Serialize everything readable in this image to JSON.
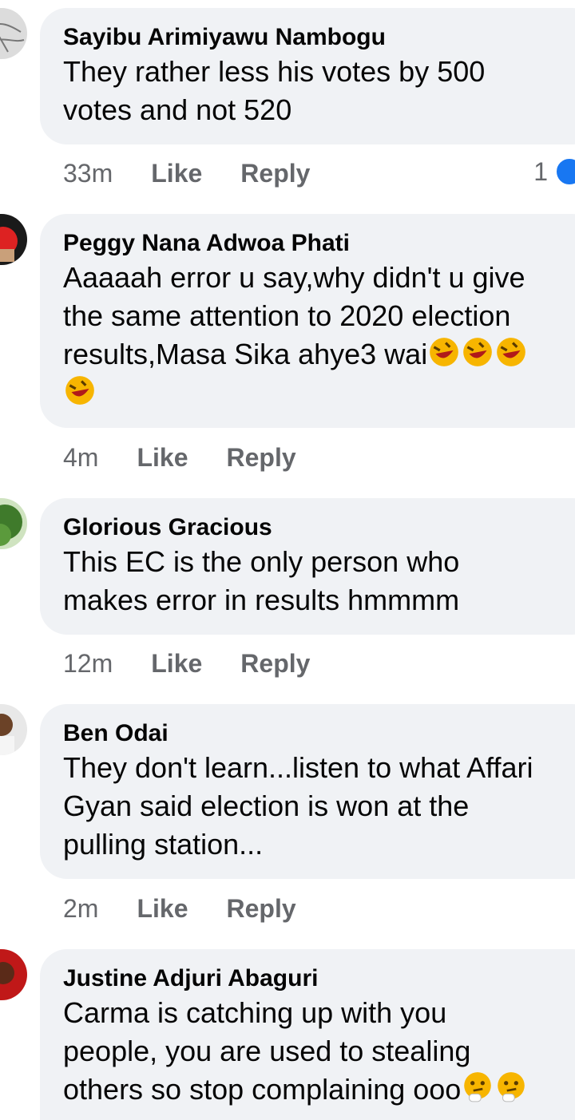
{
  "comments": [
    {
      "author": "Sayibu Arimiyawu Nambogu",
      "text": "They rather less his votes by 500\nvotes and not 520",
      "time": "33m",
      "like": "Like",
      "reply": "Reply",
      "reaction_count": "1"
    },
    {
      "author": "Peggy Nana Adwoa Phati",
      "text_line1": "Aaaaah error u say,why didn't u give",
      "text_line2": "the same attention to 2020 election",
      "text_line3": "results,Masa Sika ahye3 wai",
      "emoji": "rofl-emoji",
      "time": "4m",
      "like": "Like",
      "reply": "Reply"
    },
    {
      "author": "Glorious Gracious",
      "text": "This EC is the only person who\nmakes error in results hmmmm",
      "time": "12m",
      "like": "Like",
      "reply": "Reply"
    },
    {
      "author": "Ben Odai",
      "text": "They don't learn...listen to what Affari\nGyan said election is won at the\npulling station...",
      "time": "2m",
      "like": "Like",
      "reply": "Reply"
    },
    {
      "author": "Justine Adjuri Abaguri",
      "text_line1": "Carma is catching up with you",
      "text_line2": "people, you are used to stealing",
      "text_line3": "others so stop complaining ooo",
      "emoji": "thinking-face-emoji",
      "time": "",
      "like": "",
      "reply": ""
    }
  ],
  "colors": {
    "bubble": "#f0f2f5",
    "text": "#050505",
    "meta": "#65676b",
    "reaction_blue": "#1877f2"
  }
}
